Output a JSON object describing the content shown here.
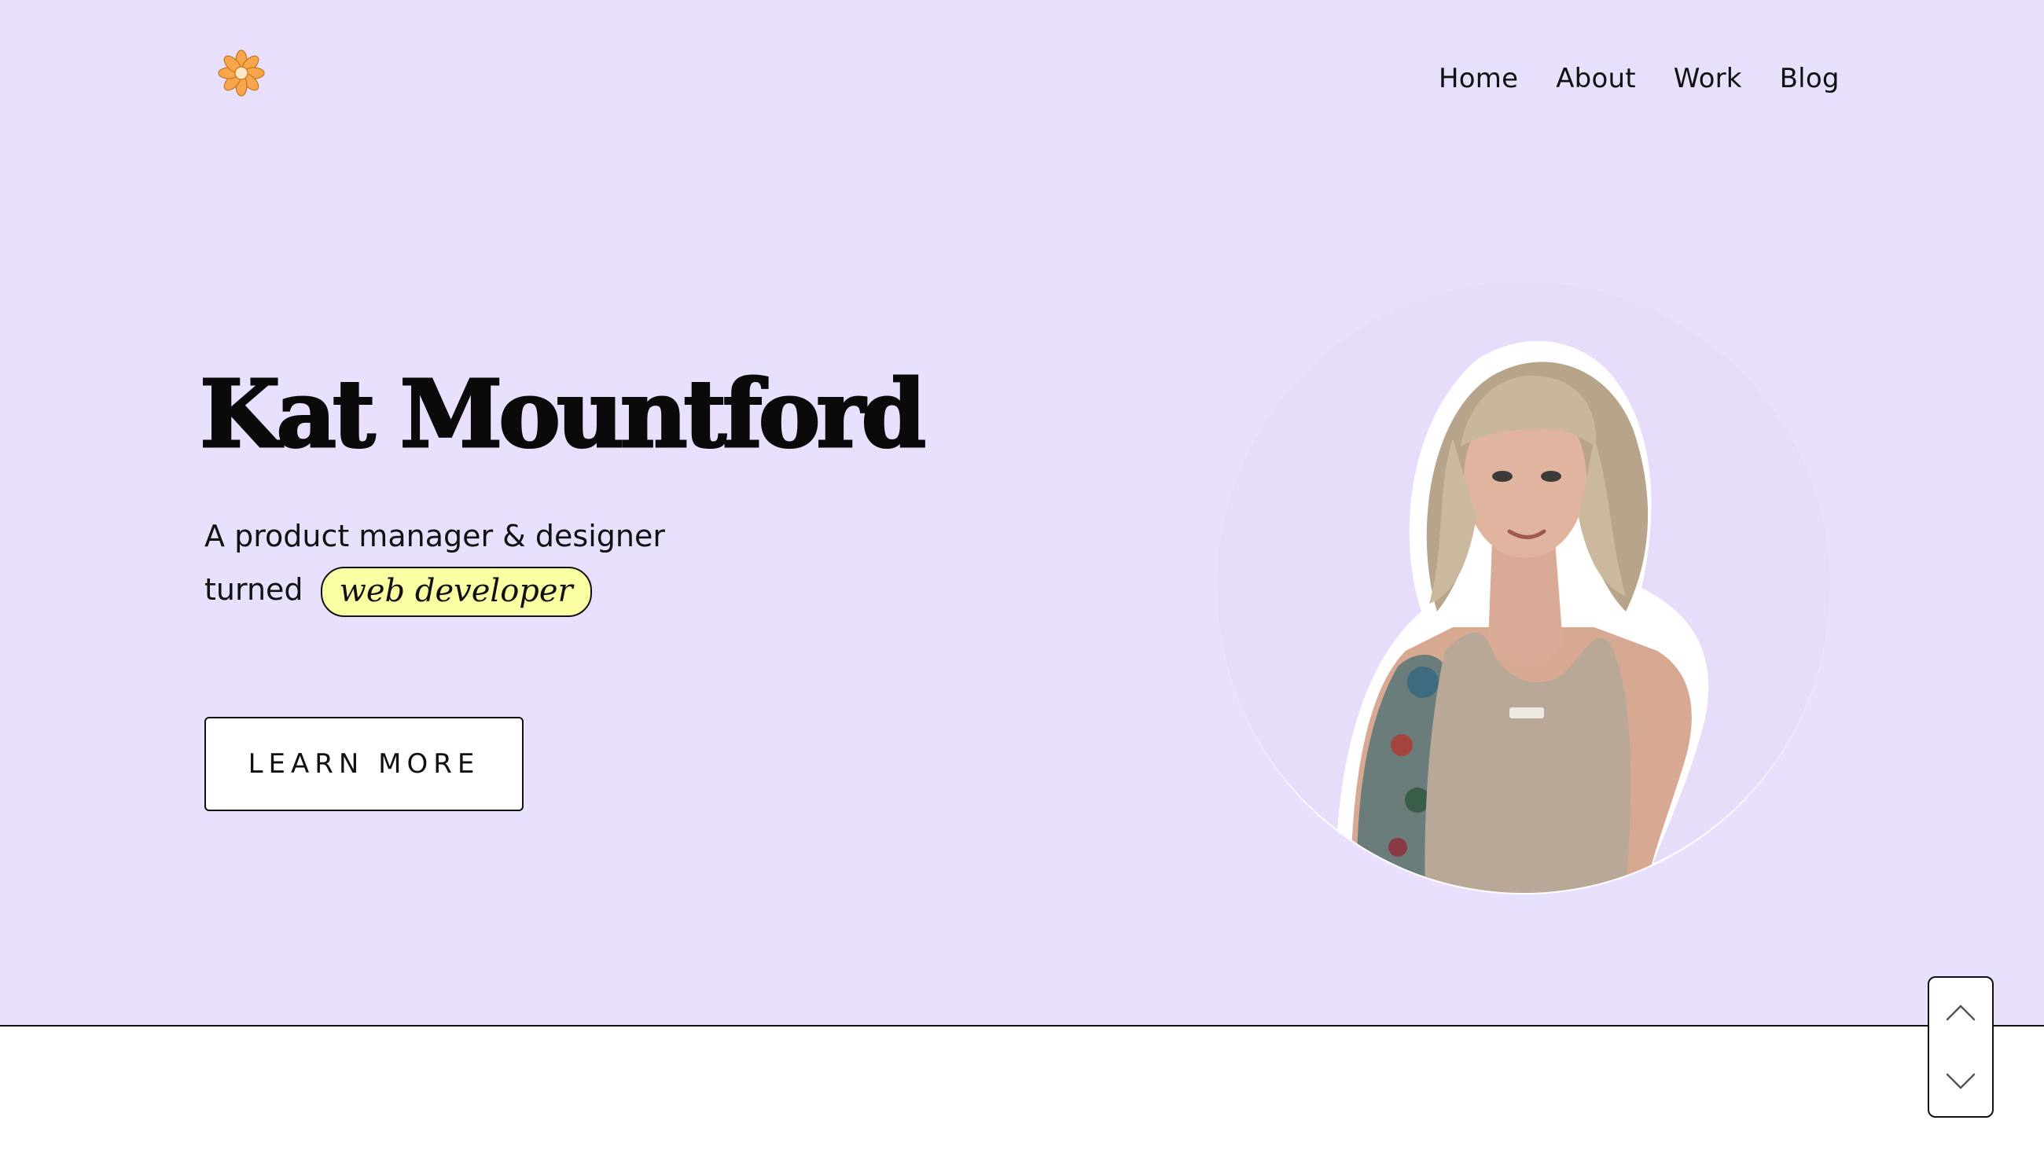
{
  "header": {
    "logo_icon": "flower-icon",
    "nav": [
      {
        "label": "Home"
      },
      {
        "label": "About"
      },
      {
        "label": "Work"
      },
      {
        "label": "Blog"
      }
    ]
  },
  "hero": {
    "name": "Kat Mountford",
    "tagline_line1": "A product manager & designer",
    "tagline_turned": "turned",
    "tagline_highlight": "web developer",
    "cta_label": "LEARN MORE",
    "portrait_icon": "profile-photo"
  },
  "scroll_controls": {
    "up_icon": "chevron-up-icon",
    "down_icon": "chevron-down-icon"
  },
  "colors": {
    "hero_background": "#e9e0fd",
    "highlight": "#fbffa4",
    "logo": "#f7a64b",
    "text": "#111111"
  }
}
